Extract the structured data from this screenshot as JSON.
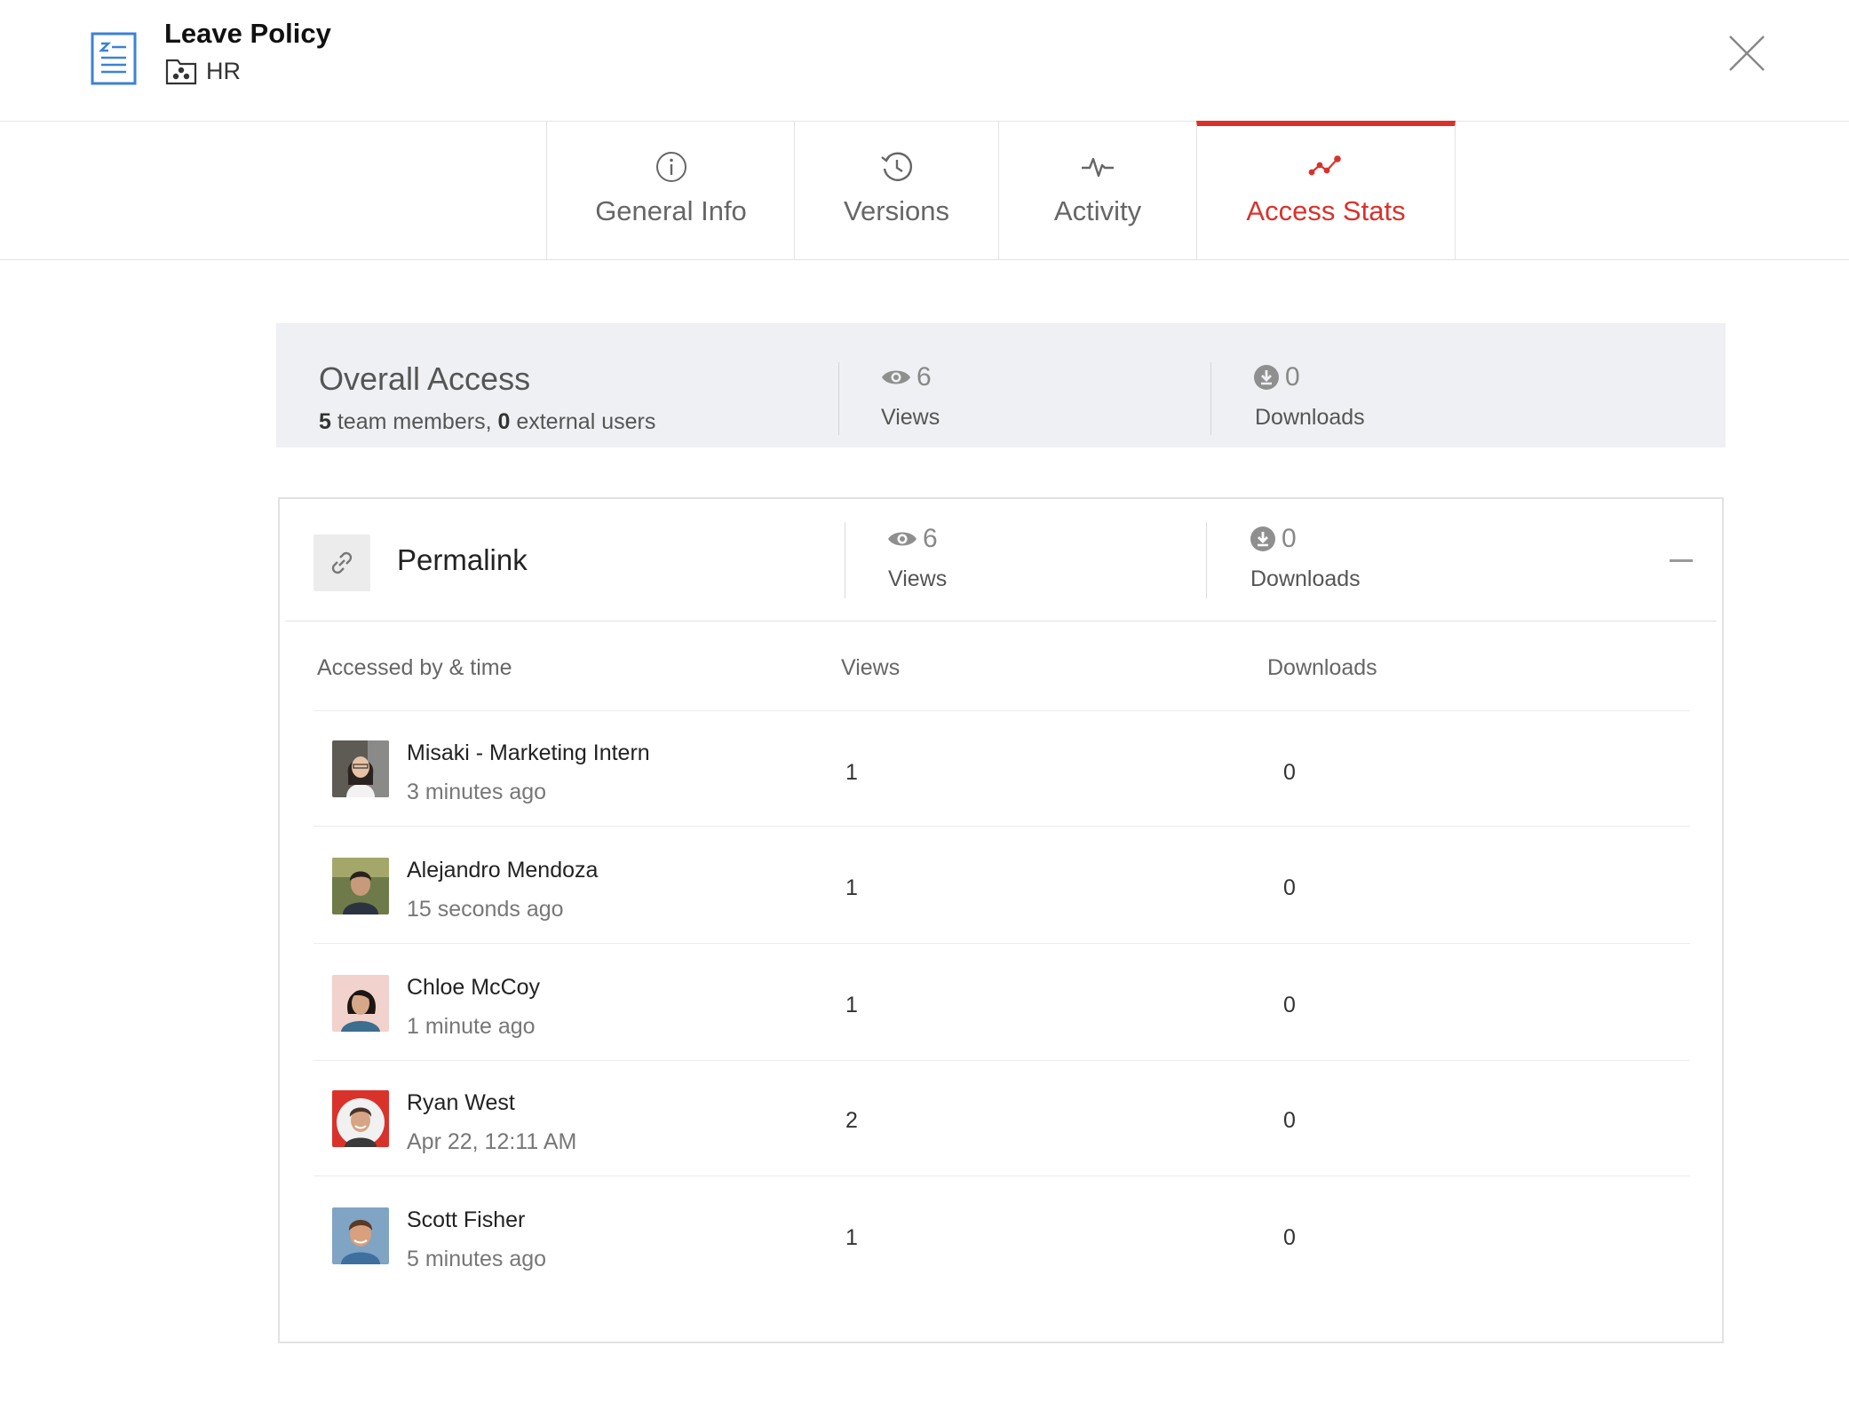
{
  "header": {
    "title": "Leave Policy",
    "folder": "HR",
    "icons": {
      "doc": "document-icon",
      "folder": "team-folder-icon",
      "close": "close-icon"
    }
  },
  "tabs": [
    {
      "label": "General Info",
      "icon": "info-icon",
      "active": false
    },
    {
      "label": "Versions",
      "icon": "history-icon",
      "active": false
    },
    {
      "label": "Activity",
      "icon": "pulse-icon",
      "active": false
    },
    {
      "label": "Access Stats",
      "icon": "stats-icon",
      "active": true
    }
  ],
  "overall": {
    "title": "Overall Access",
    "team_members": "5",
    "team_members_text": " team members, ",
    "external_users": "0",
    "external_users_text": " external users",
    "views": "6",
    "views_label": "Views",
    "downloads": "0",
    "downloads_label": "Downloads"
  },
  "permalink": {
    "title": "Permalink",
    "views": "6",
    "views_label": "Views",
    "downloads": "0",
    "downloads_label": "Downloads",
    "columns": [
      "Accessed by & time",
      "Views",
      "Downloads"
    ],
    "rows": [
      {
        "name": "Misaki - Marketing Intern",
        "time": "3 minutes ago",
        "views": "1",
        "downloads": "0"
      },
      {
        "name": "Alejandro Mendoza",
        "time": "15 seconds ago",
        "views": "1",
        "downloads": "0"
      },
      {
        "name": "Chloe McCoy",
        "time": "1 minute ago",
        "views": "1",
        "downloads": "0"
      },
      {
        "name": "Ryan West",
        "time": "Apr 22, 12:11 AM",
        "views": "2",
        "downloads": "0"
      },
      {
        "name": "Scott Fisher",
        "time": "5 minutes ago",
        "views": "1",
        "downloads": "0"
      }
    ]
  },
  "colors": {
    "accent": "#d9322b",
    "doc_icon": "#3b82d6",
    "panel_bg": "#eef0f3"
  }
}
